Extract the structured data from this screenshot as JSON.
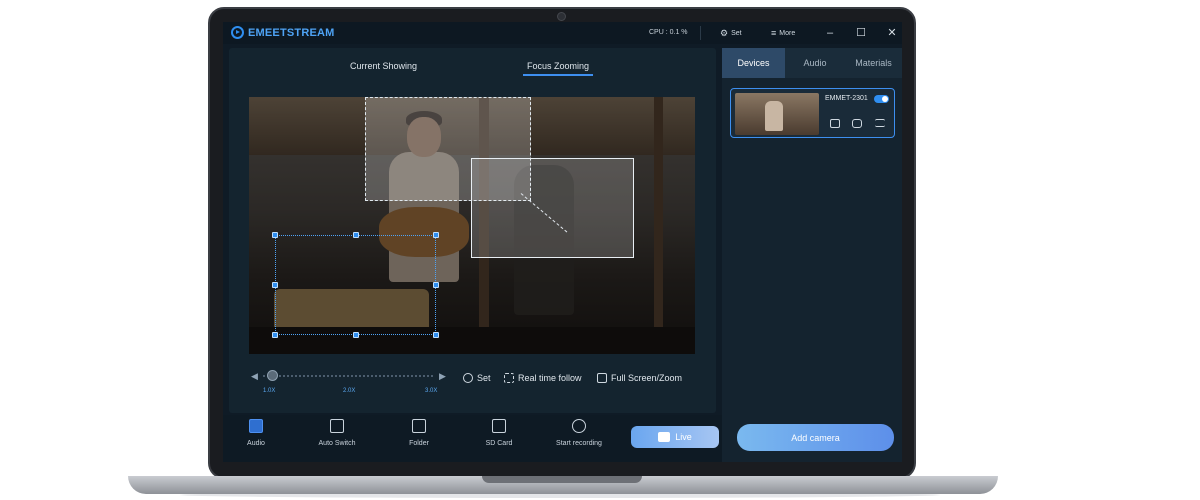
{
  "app": {
    "name": "EMEETSTREAM",
    "cpu": "CPU : 0.1 %",
    "menu_set": "Set",
    "menu_more": "More"
  },
  "preview": {
    "tabs": [
      {
        "label": "Current Showing",
        "active": false
      },
      {
        "label": "Focus Zooming",
        "active": true
      }
    ],
    "zoom_labels": [
      "1.0X",
      "2.0X",
      "3.0X"
    ],
    "zoom_level": 1.0,
    "tools": {
      "set": "Set",
      "real_time_follow": "Real time follow",
      "full_screen_zoom": "Full Screen/Zoom"
    }
  },
  "bottombar": {
    "items": [
      {
        "label": "Audio",
        "icon": "audio-icon"
      },
      {
        "label": "Auto Switch",
        "icon": "auto-switch-icon"
      },
      {
        "label": "Folder",
        "icon": "folder-icon"
      },
      {
        "label": "SD Card",
        "icon": "sd-card-icon"
      },
      {
        "label": "Start recording",
        "icon": "record-icon"
      }
    ],
    "live": "Live"
  },
  "right_panel": {
    "tabs": [
      {
        "label": "Devices",
        "active": true
      },
      {
        "label": "Audio",
        "active": false
      },
      {
        "label": "Materials",
        "active": false
      }
    ],
    "device": {
      "name": "EMMET-2301",
      "enabled": true
    },
    "add_camera": "Add camera"
  },
  "colors": {
    "accent": "#2f8ef0",
    "background": "#0f1b26"
  }
}
